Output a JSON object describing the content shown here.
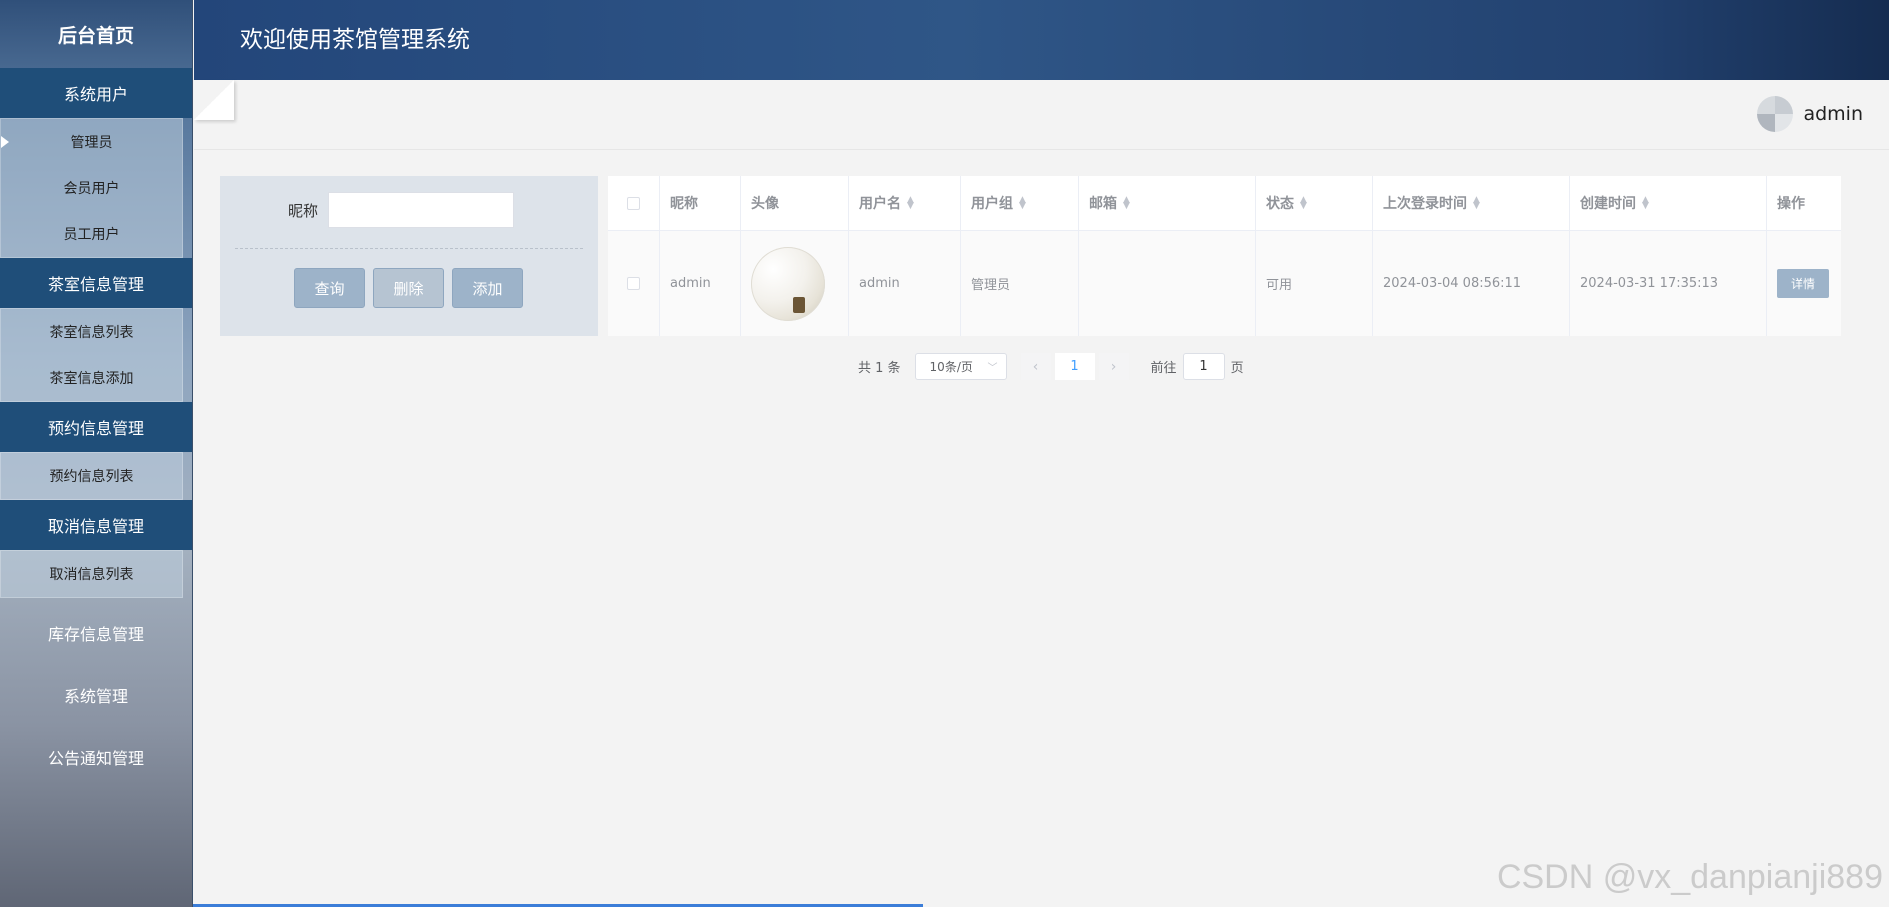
{
  "sidebar": {
    "home": "后台首页",
    "groups": [
      {
        "title": "系统用户",
        "items": [
          "管理员",
          "会员用户",
          "员工用户"
        ]
      },
      {
        "title": "茶室信息管理",
        "items": [
          "茶室信息列表",
          "茶室信息添加"
        ]
      },
      {
        "title": "预约信息管理",
        "items": [
          "预约信息列表"
        ]
      },
      {
        "title": "取消信息管理",
        "items": [
          "取消信息列表"
        ]
      },
      {
        "title": "库存信息管理",
        "items": []
      },
      {
        "title": "系统管理",
        "items": []
      },
      {
        "title": "公告通知管理",
        "items": []
      }
    ]
  },
  "topbar": {
    "title": "欢迎使用茶馆管理系统"
  },
  "user": {
    "name": "admin"
  },
  "search": {
    "label": "昵称",
    "value": "",
    "buttons": {
      "query": "查询",
      "delete": "删除",
      "add": "添加"
    }
  },
  "table": {
    "headers": [
      "昵称",
      "头像",
      "用户名",
      "用户组",
      "邮箱",
      "状态",
      "上次登录时间",
      "创建时间",
      "操作"
    ],
    "rows": [
      {
        "nickname": "admin",
        "username": "admin",
        "group": "管理员",
        "email": "",
        "status": "可用",
        "last_login": "2024-03-04 08:56:11",
        "created": "2024-03-31 17:35:13",
        "action": "详情"
      }
    ]
  },
  "pager": {
    "total": "共 1 条",
    "page_size": "10条/页",
    "current": "1",
    "goto_label": "前往",
    "goto_value": "1",
    "page_unit": "页"
  },
  "watermark": "CSDN @vx_danpianji889"
}
